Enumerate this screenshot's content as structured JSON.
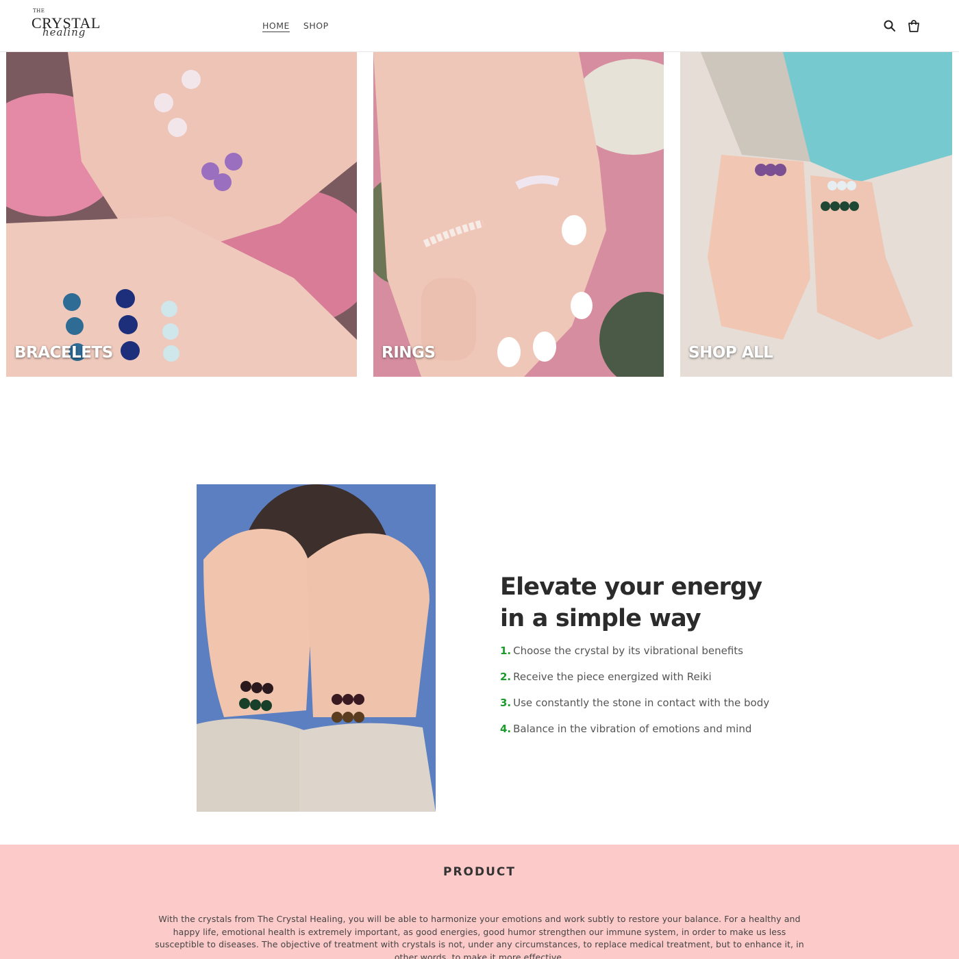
{
  "header": {
    "logo": {
      "line1": "THE",
      "line2": "CRYSTAL",
      "line3": "healing"
    },
    "nav": [
      {
        "label": "HOME",
        "active": true
      },
      {
        "label": "SHOP",
        "active": false
      }
    ],
    "icons": {
      "search": "search-icon",
      "cart": "cart-icon"
    }
  },
  "collections": [
    {
      "label": "BRACELETS"
    },
    {
      "label": "RINGS"
    },
    {
      "label": "SHOP ALL"
    }
  ],
  "feature": {
    "title": "Elevate your energy in a simple way",
    "steps": [
      {
        "num": "1.",
        "text": "Choose the crystal by its vibrational benefits"
      },
      {
        "num": "2.",
        "text": "Receive the piece energized with Reiki"
      },
      {
        "num": "3.",
        "text": "Use constantly the stone in contact with the body"
      },
      {
        "num": "4.",
        "text": "Balance in the vibration of emotions and mind"
      }
    ],
    "accent_color": "#1a9a2a"
  },
  "product": {
    "title": "PRODUCT",
    "text": "With the crystals from The Crystal Healing, you will be able to harmonize your emotions and work subtly to restore your balance. For a healthy and happy life, emotional health is extremely important, as good energies, good humor strengthen our immune system, in order to make us less susceptible to diseases. The objective of treatment with crystals is not, under any circumstances, to replace medical treatment, but to enhance it, in other words, to make it more effective.",
    "background": "#fdcaca"
  }
}
